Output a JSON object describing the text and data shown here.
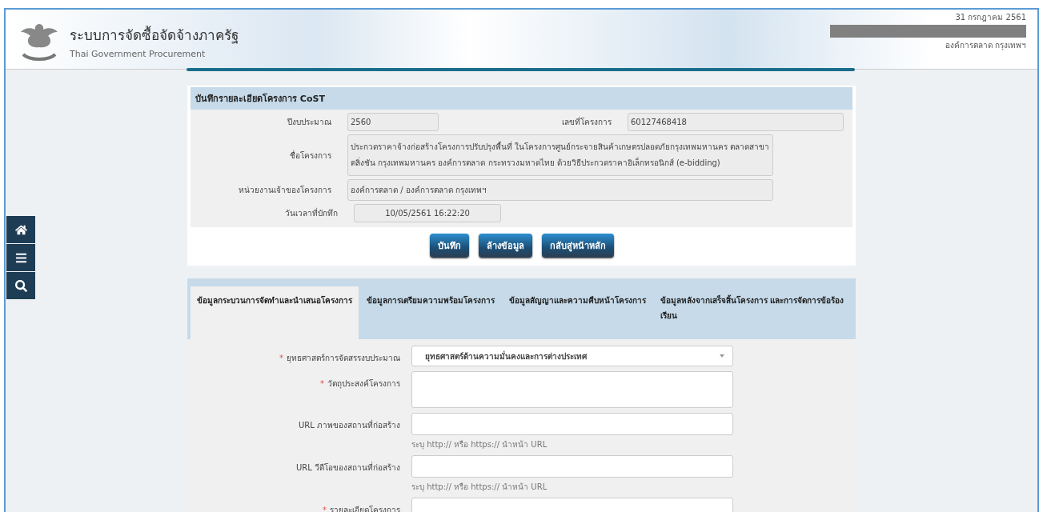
{
  "header": {
    "title": "ระบบการจัดซื้อจัดจ้างภาครัฐ",
    "subtitle": "Thai Government Procurement",
    "date": "31 กรกฎาคม 2561",
    "org": "องค์การตลาด กรุงเทพฯ"
  },
  "project_card": {
    "title": "บันทึกรายละเอียดโครงการ CoST",
    "fiscal_year": {
      "label": "ปีงบประมาณ",
      "value": "2560"
    },
    "project_number": {
      "label": "เลขที่โครงการ",
      "value": "60127468418"
    },
    "project_name": {
      "label": "ชื่อโครงการ",
      "value": "ประกวดราคาจ้างก่อสร้างโครงการปรับปรุงพื้นที่ ในโครงการศูนย์กระจายสินค้าเกษตรปลอดภัยกรุงเทพมหานคร ตลาดสาขาตลิ่งชัน กรุงเทพมหานคร องค์การตลาด กระทรวงมหาดไทย ด้วยวิธีประกวดราคาอิเล็กทรอนิกส์ (e-bidding)"
    },
    "owner_agency": {
      "label": "หน่วยงานเจ้าของโครงการ",
      "value": "องค์การตลาด / องค์การตลาด กรุงเทพฯ"
    },
    "saved_at": {
      "label": "วันเวลาที่บักทึก",
      "value": "10/05/2561 16:22:20"
    }
  },
  "buttons": [
    "บันทึก",
    "ล้างข้อมูล",
    "กลับสู่หน้าหลัก"
  ],
  "tabs": [
    {
      "label": "ข้อมูลกระบวนการจัดทำและนำเสนอโครงการ",
      "selected": true
    },
    {
      "label": "ข้อมูลการเตรียมความพร้อมโครงการ",
      "selected": false
    },
    {
      "label": "ข้อมูลสัญญาและความคืบหน้าโครงการ",
      "selected": false
    },
    {
      "label": "ข้อมูลหลังจากเสร็จสิ้นโครงการ และการจัดการข้อร้องเรียน",
      "selected": false
    }
  ],
  "form": [
    {
      "kind": "select",
      "label": "ยุทธศาสตร์การจัดสรรงบประมาณ",
      "required_mark": "*",
      "value": "ยุทธศาสตร์ด้านความมั่นคงและการต่างประเทศ"
    },
    {
      "kind": "textarea",
      "label": "วัตถุประสงค์โครงการ",
      "required_mark": "*"
    },
    {
      "kind": "input",
      "label": "URL ภาพของสถานที่ก่อสร้าง",
      "help": "ระบุ http:// หรือ https:// นำหน้า URL"
    },
    {
      "kind": "input",
      "label": "URL วีดีโอของสถานที่ก่อสร้าง",
      "help": "ระบุ http:// หรือ https:// นำหน้า URL"
    },
    {
      "kind": "textarea",
      "label": "รายละเอียดโครงการ",
      "required_mark": "*"
    }
  ]
}
